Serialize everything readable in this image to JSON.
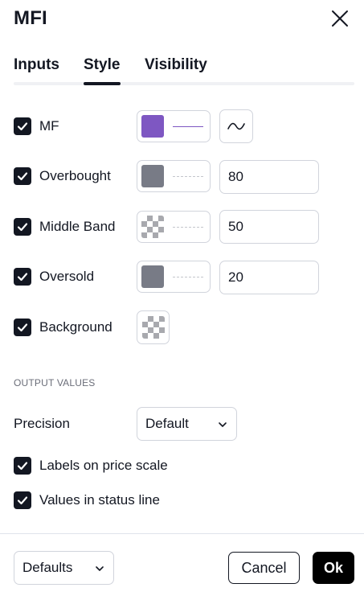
{
  "dialog": {
    "title": "MFI"
  },
  "tabs": [
    {
      "label": "Inputs"
    },
    {
      "label": "Style",
      "active": true
    },
    {
      "label": "Visibility"
    }
  ],
  "style_rows": [
    {
      "label": "MF",
      "checked": true,
      "color": "#7e57c2",
      "line_style": "solid",
      "plot_style_icon": "line-wave-icon"
    },
    {
      "label": "Overbought",
      "checked": true,
      "color": "#787b86",
      "line_style": "dashed",
      "value": "80"
    },
    {
      "label": "Middle Band",
      "checked": true,
      "color": "transparent",
      "line_style": "dashed",
      "value": "50"
    },
    {
      "label": "Oversold",
      "checked": true,
      "color": "#787b86",
      "line_style": "dashed",
      "value": "20"
    },
    {
      "label": "Background",
      "checked": true,
      "color": "transparent"
    }
  ],
  "output_values": {
    "section_title": "OUTPUT VALUES",
    "precision_label": "Precision",
    "precision_value": "Default",
    "labels_on_price_scale": {
      "label": "Labels on price scale",
      "checked": true
    },
    "values_in_status_line": {
      "label": "Values in status line",
      "checked": true
    }
  },
  "footer": {
    "defaults_label": "Defaults",
    "cancel_label": "Cancel",
    "ok_label": "Ok"
  },
  "colors": {
    "text": "#131722",
    "border": "#d1d4dc",
    "mf_purple": "#7e57c2",
    "gray_swatch": "#787b86",
    "ok_button": "#000000"
  }
}
